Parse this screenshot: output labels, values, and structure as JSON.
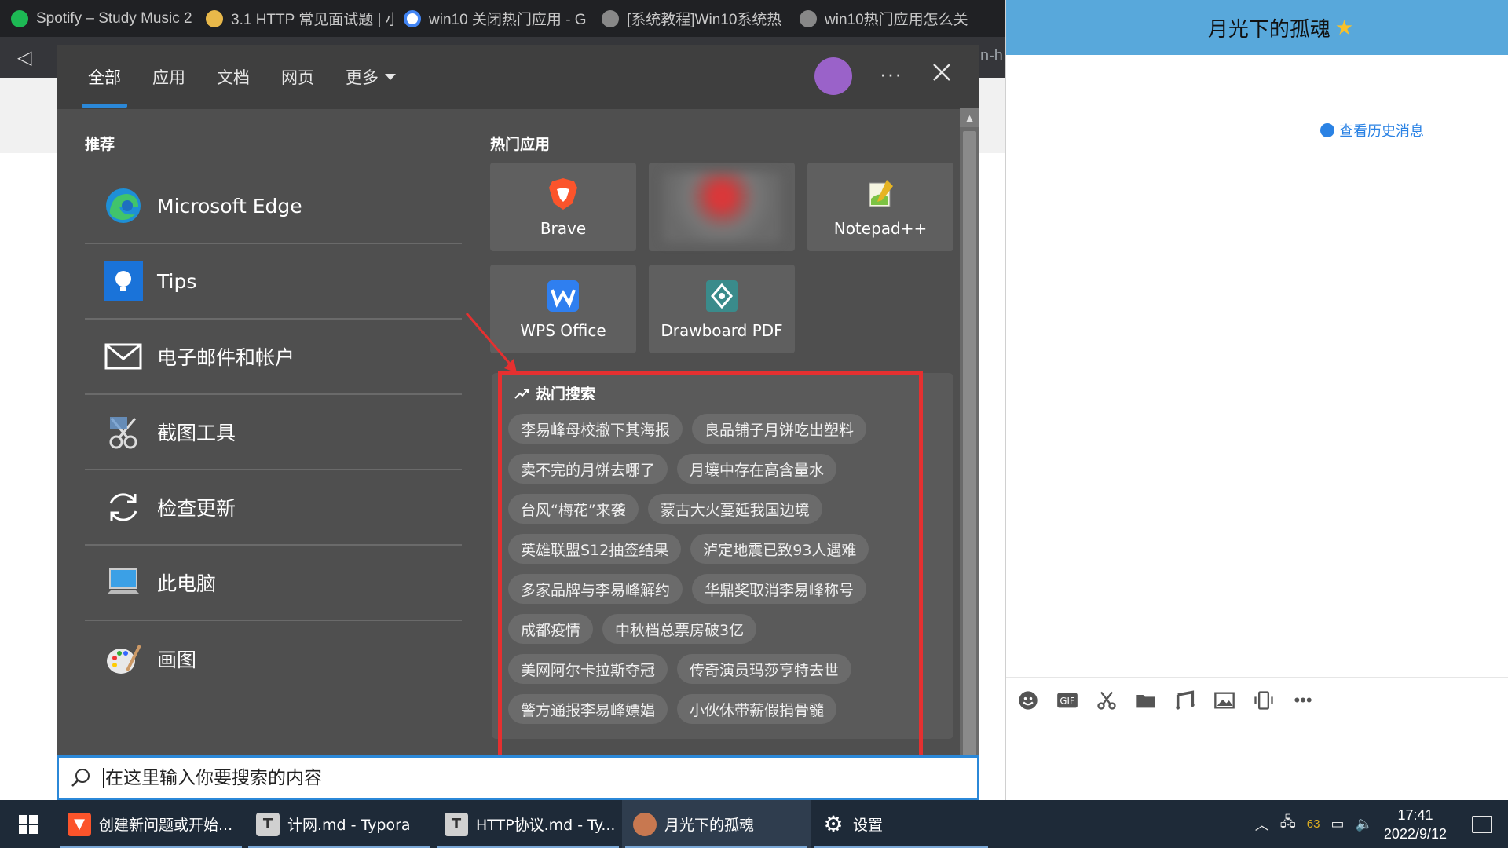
{
  "browser": {
    "tabs": [
      {
        "title": "Spotify – Study Music 2",
        "color": "#1db954"
      },
      {
        "title": "3.1 HTTP 常见面试题 | 小",
        "color": "#e8b84a"
      },
      {
        "title": "win10 关闭热门应用 - G",
        "color": "#4285f4"
      },
      {
        "title": "[系统教程]Win10系统热",
        "color": "#888888"
      },
      {
        "title": "win10热门应用怎么关",
        "color": "#888888"
      }
    ],
    "omnibox_fragment": "n-h"
  },
  "chat": {
    "title": "月光下的孤魂",
    "history_link": "查看历史消息",
    "header_color": "#58a8db"
  },
  "panel": {
    "tabs": [
      "全部",
      "应用",
      "文档",
      "网页",
      "更多"
    ],
    "active_tab": "全部",
    "more_label": "···",
    "recommend_title": "推荐",
    "recommend": [
      {
        "label": "Microsoft Edge",
        "icon": "edge-icon"
      },
      {
        "label": "Tips",
        "icon": "tips-icon"
      },
      {
        "label": "电子邮件和帐户",
        "icon": "mail-icon"
      },
      {
        "label": "截图工具",
        "icon": "snipping-tool-icon"
      },
      {
        "label": "检查更新",
        "icon": "refresh-icon"
      },
      {
        "label": "此电脑",
        "icon": "computer-icon"
      },
      {
        "label": "画图",
        "icon": "paint-icon"
      }
    ],
    "hot_apps_title": "热门应用",
    "hot_apps": [
      {
        "label": "Brave",
        "icon": "brave-icon"
      },
      {
        "label": "",
        "icon": "blurred-app-icon"
      },
      {
        "label": "Notepad++",
        "icon": "notepad-plus-icon"
      },
      {
        "label": "WPS Office",
        "icon": "wps-icon"
      },
      {
        "label": "Drawboard PDF",
        "icon": "drawboard-icon"
      }
    ],
    "hot_search_title": "热门搜索",
    "hot_searches": [
      [
        "李易峰母校撤下其海报",
        "良品铺子月饼吃出塑料"
      ],
      [
        "卖不完的月饼去哪了",
        "月壤中存在高含量水"
      ],
      [
        "台风“梅花”来袭",
        "蒙古大火蔓延我国边境"
      ],
      [
        "英雄联盟S12抽签结果",
        "泸定地震已致93人遇难"
      ],
      [
        "多家品牌与李易峰解约",
        "华鼎奖取消李易峰称号"
      ],
      [
        "成都疫情",
        "中秋档总票房破3亿"
      ],
      [
        "美网阿尔卡拉斯夺冠",
        "传奇演员玛莎亨特去世"
      ],
      [
        "警方通报李易峰嫖娼",
        "小伙休带薪假捐骨髓"
      ]
    ],
    "search_placeholder": "在这里输入你要搜索的内容",
    "highlight_color": "#e53030"
  },
  "taskbar": {
    "items": [
      {
        "label": "创建新问题或开始...",
        "icon": "brave-icon",
        "color": "#fb542b"
      },
      {
        "label": "计网.md - Typora",
        "icon": "typora-icon",
        "color": "#d0d0d0"
      },
      {
        "label": "HTTP协议.md - Ty...",
        "icon": "typora-icon",
        "color": "#d0d0d0"
      },
      {
        "label": "月光下的孤魂",
        "icon": "chat-avatar-icon",
        "color": "#c87850"
      },
      {
        "label": "设置",
        "icon": "gear-icon",
        "color": "#ffffff"
      }
    ],
    "tray_number": "63",
    "time": "17:41",
    "date": "2022/9/12"
  }
}
